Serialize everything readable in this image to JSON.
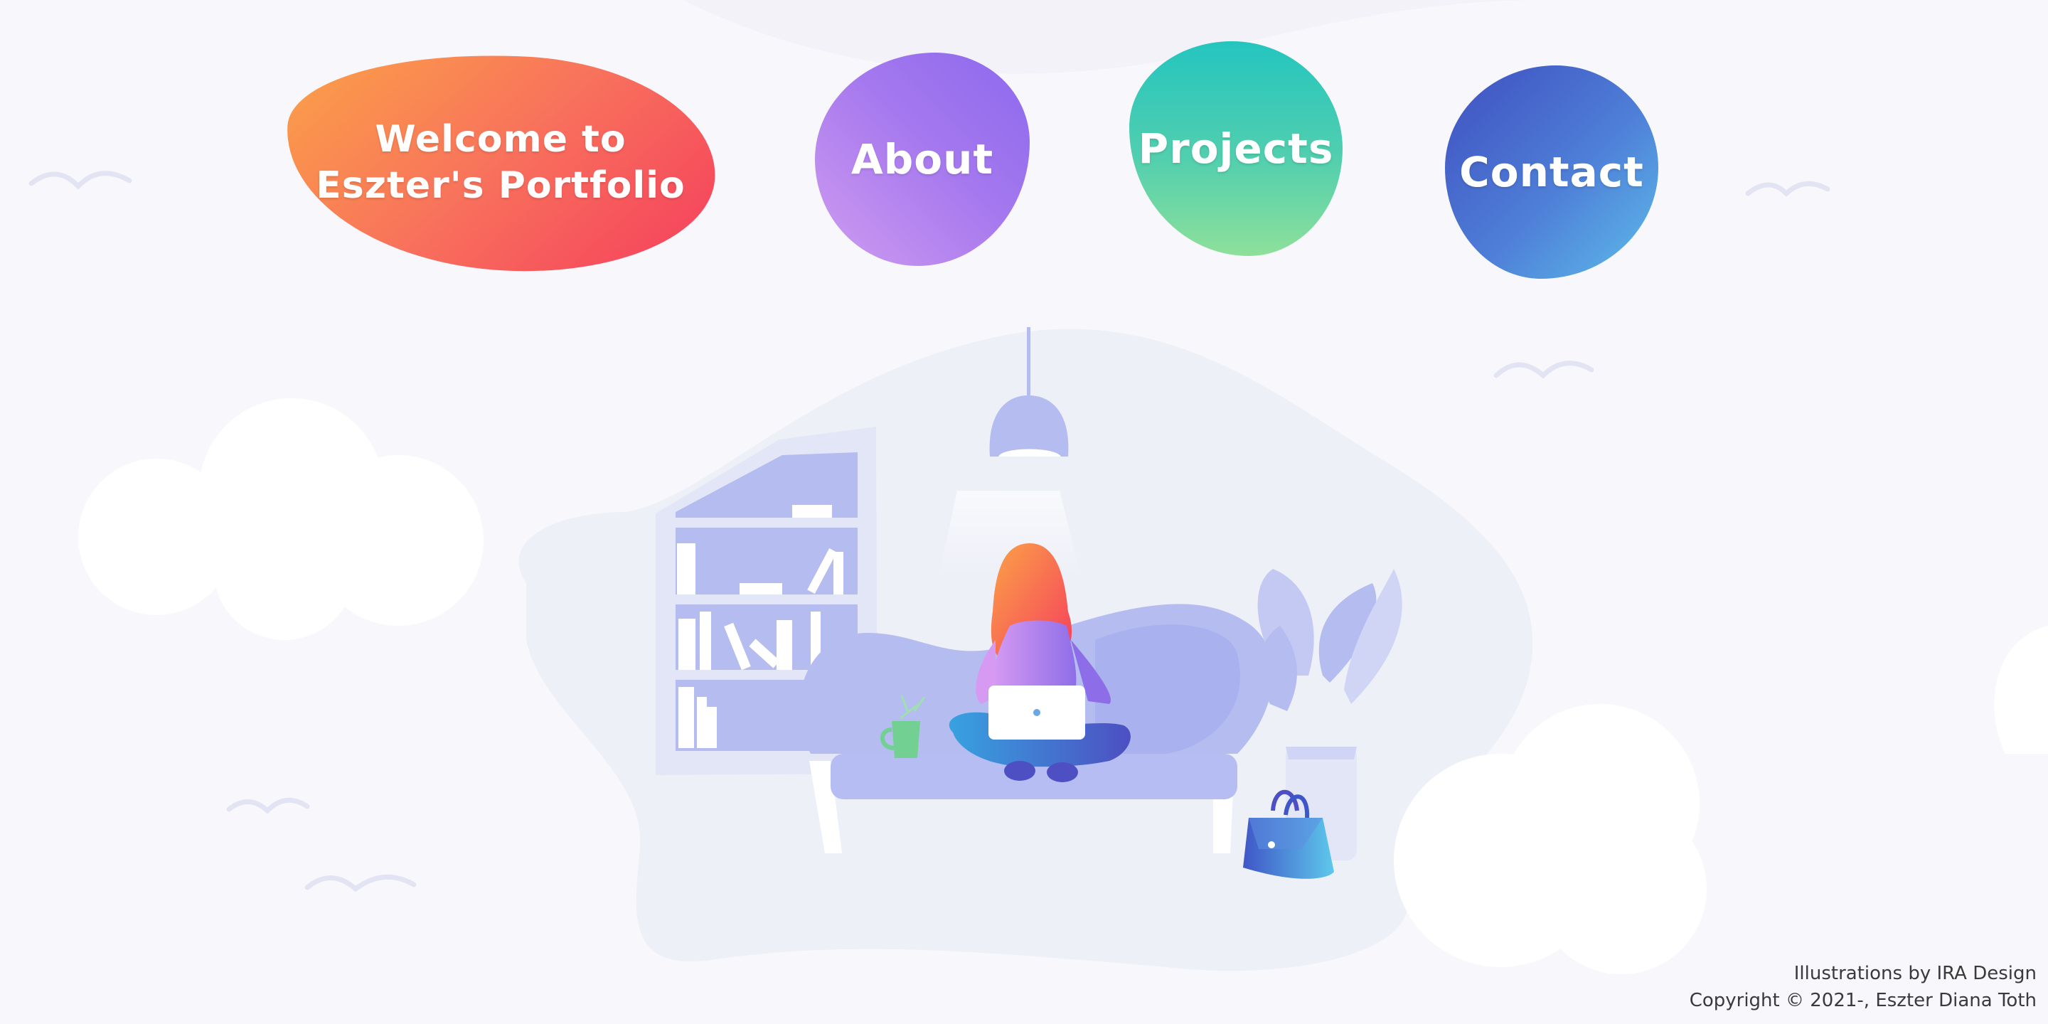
{
  "nav": {
    "welcome_label": "Welcome to Eszter's Portfolio",
    "about_label": "About",
    "projects_label": "Projects",
    "contact_label": "Contact"
  },
  "footer": {
    "illustration_credit": "Illustrations by IRA Design",
    "copyright": "Copyright © 2021-, Eszter Diana Toth"
  },
  "illustration": {
    "subject": "woman-with-laptop-on-sofa"
  },
  "colors": {
    "background": "#f8f8fc",
    "welcome_gradient": [
      "#fba347",
      "#f53d5d"
    ],
    "about_gradient": [
      "#d09cf0",
      "#8b69ee"
    ],
    "projects_gradient": [
      "#24c5bf",
      "#8ee09a"
    ],
    "contact_gradient": [
      "#3f4fc0",
      "#5dbde9"
    ]
  }
}
